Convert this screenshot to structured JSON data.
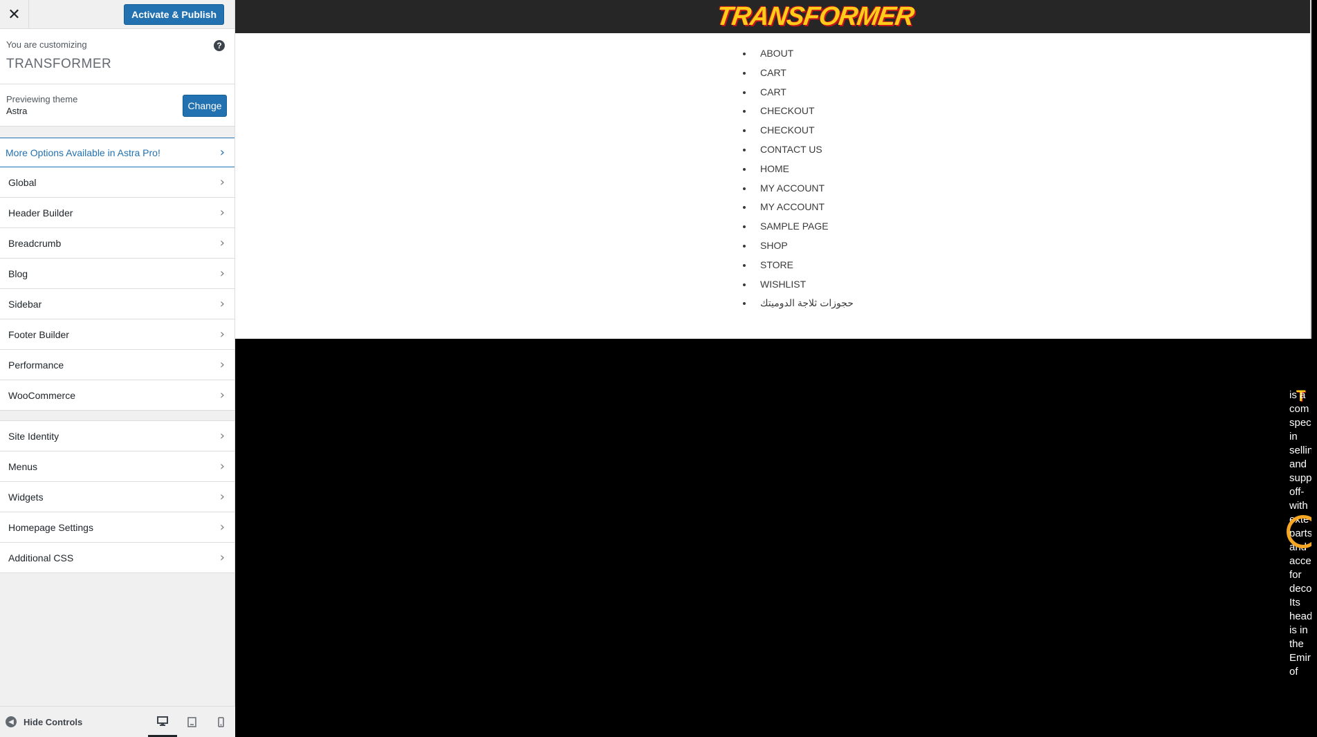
{
  "sidebar": {
    "publish_label": "Activate & Publish",
    "customizing_label": "You are customizing",
    "site_title": "TRANSFORMER",
    "previewing_label": "Previewing theme",
    "theme_name": "Astra",
    "change_label": "Change",
    "promo_label": "More Options Available in Astra Pro!",
    "sections_primary": [
      {
        "label": "Global"
      },
      {
        "label": "Header Builder"
      },
      {
        "label": "Breadcrumb"
      },
      {
        "label": "Blog"
      },
      {
        "label": "Sidebar"
      },
      {
        "label": "Footer Builder"
      },
      {
        "label": "Performance"
      },
      {
        "label": "WooCommerce"
      }
    ],
    "sections_secondary": [
      {
        "label": "Site Identity"
      },
      {
        "label": "Menus"
      },
      {
        "label": "Widgets"
      },
      {
        "label": "Homepage Settings"
      },
      {
        "label": "Additional CSS"
      }
    ],
    "hide_controls_label": "Hide Controls",
    "accent_color": "#2271b1"
  },
  "preview": {
    "logo_text": "TRANSFORMER",
    "nav_items": [
      "ABOUT",
      "CART",
      "CART",
      "CHECKOUT",
      "CHECKOUT",
      "CONTACT US",
      "HOME",
      "MY ACCOUNT",
      "MY ACCOUNT",
      "SAMPLE PAGE",
      "SHOP",
      "STORE",
      "WISHLIST",
      "حجوزات ثلاجة الدوميتك"
    ],
    "overflow_words": "is a com spec in sellin and supp off- with exte parts and acce for deco Its head is in the Emir of"
  },
  "icons": {
    "close": "close-icon",
    "help": "help-icon",
    "chevron": "chevron-right-icon",
    "hide_controls": "arrow-left-circle-icon",
    "desktop": "desktop-icon",
    "tablet": "tablet-icon",
    "mobile": "mobile-icon"
  }
}
